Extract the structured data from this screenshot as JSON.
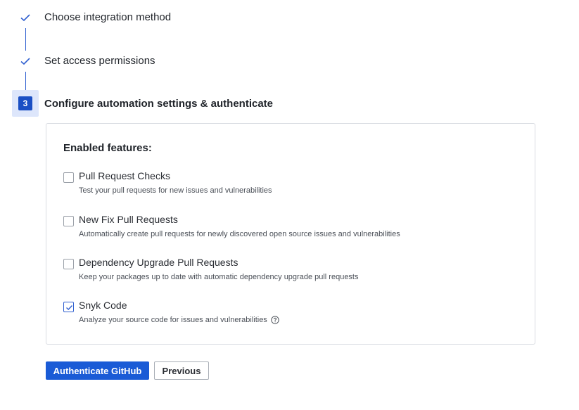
{
  "steps": [
    {
      "label": "Choose integration method",
      "status": "done",
      "icon": "check-icon"
    },
    {
      "label": "Set access permissions",
      "status": "done",
      "icon": "check-icon"
    },
    {
      "label": "Configure automation settings & authenticate",
      "status": "active",
      "number": "3"
    }
  ],
  "panel": {
    "heading": "Enabled features:",
    "features": [
      {
        "label": "Pull Request Checks",
        "description": "Test your pull requests for new issues and vulnerabilities",
        "checked": false
      },
      {
        "label": "New Fix Pull Requests",
        "description": "Automatically create pull requests for newly discovered open source issues and vulnerabilities",
        "checked": false
      },
      {
        "label": "Dependency Upgrade Pull Requests",
        "description": "Keep your packages up to date with automatic dependency upgrade pull requests",
        "checked": false
      },
      {
        "label": "Snyk Code",
        "description": "Analyze your source code for issues and vulnerabilities",
        "checked": true,
        "help_icon": "help-circle-icon"
      }
    ]
  },
  "actions": {
    "primary_label": "Authenticate GitHub",
    "secondary_label": "Previous"
  },
  "colors": {
    "accent": "#1a5bd6",
    "step_active_bg": "#dde6fb",
    "border": "#d9dce2"
  }
}
